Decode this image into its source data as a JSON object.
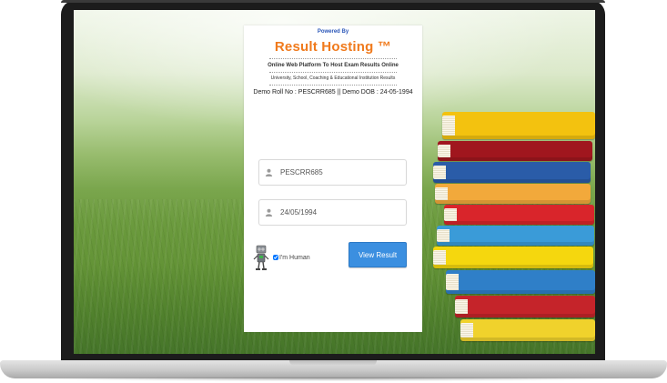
{
  "card": {
    "powered_by": "Powered By",
    "brand": "Result Hosting ™",
    "tagline": "Online Web Platform To Host Exam Results Online",
    "subline": "University, School, Coaching & Educational Institution Results",
    "demo_text": "Demo Roll No : PESCRR685 || Demo DOB : 24-05-1994"
  },
  "form": {
    "roll_value": "PESCRR685",
    "dob_value": "24/05/1994",
    "human_label": "I'm Human",
    "human_checked": true,
    "submit_label": "View Result"
  },
  "colors": {
    "brand": "#f07a1c",
    "powered": "#2a56b8",
    "button": "#3b8fe0"
  },
  "icons": {
    "field_icon": "user-icon",
    "captcha_icon": "robot-icon"
  }
}
